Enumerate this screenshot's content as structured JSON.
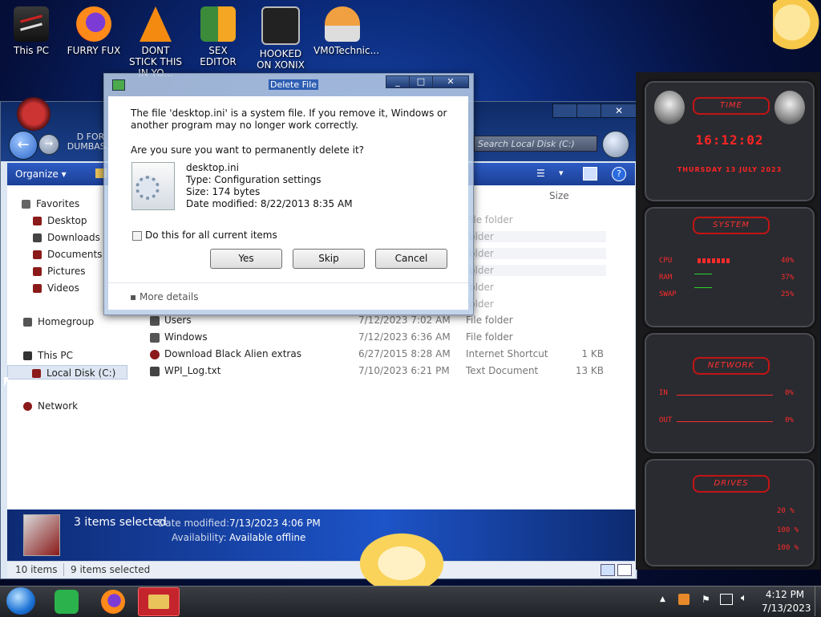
{
  "desktop_icons": [
    {
      "label": "This PC"
    },
    {
      "label": "FURRY FUX"
    },
    {
      "label": "DONT STICK THIS IN YO..."
    },
    {
      "label": "SEX EDITOR"
    },
    {
      "label": "HOOKED ON XONIX"
    },
    {
      "label": "VM0Technic..."
    },
    {
      "label": "D FOR DUMBAS..."
    }
  ],
  "explorer": {
    "search_placeholder": "Search Local Disk (C:)",
    "organize_label": "Organize",
    "column_size": "Size",
    "sidebar": {
      "favorites": "Favorites",
      "desktop": "Desktop",
      "downloads": "Downloads",
      "documents": "Documents",
      "pictures": "Pictures",
      "videos": "Videos",
      "homegroup": "Homegroup",
      "this_pc": "This PC",
      "local_disk": "Local Disk (C:)",
      "network": "Network"
    },
    "ghost_types": [
      "File folder",
      "folder",
      "folder",
      "folder",
      "folder",
      "folder"
    ],
    "rows": [
      {
        "name": "Users",
        "date": "7/12/2023 7:02 AM",
        "type": "File folder",
        "size": ""
      },
      {
        "name": "Windows",
        "date": "7/12/2023 6:36 AM",
        "type": "File folder",
        "size": ""
      },
      {
        "name": "Download Black Alien extras",
        "date": "6/27/2015 8:28 AM",
        "type": "Internet Shortcut",
        "size": "1 KB"
      },
      {
        "name": "WPI_Log.txt",
        "date": "7/10/2023 6:21 PM",
        "type": "Text Document",
        "size": "13 KB"
      }
    ],
    "details": {
      "selected": "3 items selected",
      "date_label": "Date modified:",
      "date_value": "7/13/2023 4:06 PM",
      "avail_label": "Availability:",
      "avail_value": "Available offline"
    },
    "status": {
      "items": "10 items",
      "selected": "9 items selected"
    }
  },
  "dialog": {
    "title": "Delete File",
    "message": "The file 'desktop.ini' is a system file. If you remove it, Windows or another program may no longer work correctly.",
    "question": "Are you sure you want to permanently delete it?",
    "file_name": "desktop.ini",
    "file_type": "Type: Configuration settings",
    "file_size": "Size: 174 bytes",
    "file_date": "Date modified: 8/22/2013 8:35 AM",
    "checkbox_label": "Do this for all current items",
    "yes": "Yes",
    "skip": "Skip",
    "cancel": "Cancel",
    "more_details": "More details"
  },
  "gadget": {
    "time_title": "TIME",
    "time": "16:12:02",
    "date": "THURSDAY 13 JULY 2023",
    "system_title": "SYSTEM",
    "cpu_label": "CPU",
    "cpu_value": "40%",
    "ram_label": "RAM",
    "ram_value": "37%",
    "swap_label": "SWAP",
    "swap_value": "25%",
    "network_title": "NETWORK",
    "in_label": "IN",
    "in_value": "0%",
    "out_label": "OUT",
    "out_value": "0%",
    "drives_title": "DRIVES",
    "drive_values": [
      "20 %",
      "100 %",
      "100 %"
    ]
  },
  "taskbar": {
    "time": "4:12 PM",
    "date": "7/13/2023"
  },
  "colors": {
    "accent_red": "#ff2a2a",
    "explorer_blue": "#1b3f96"
  }
}
